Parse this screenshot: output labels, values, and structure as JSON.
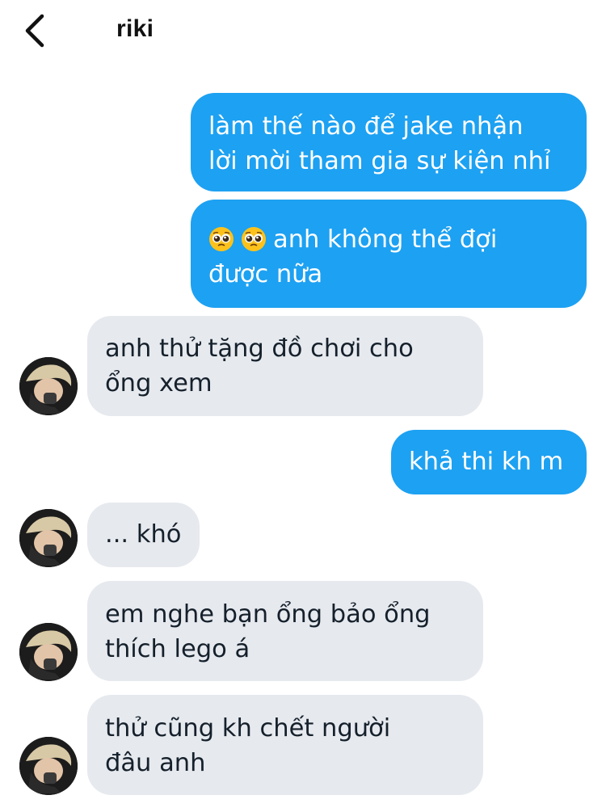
{
  "header": {
    "title": "riki",
    "back_icon": "chevron-left-icon"
  },
  "messages": [
    {
      "side": "out",
      "lines": [
        "làm thế nào để jake nhận",
        "lời mời tham gia sự kiện nhỉ"
      ]
    },
    {
      "side": "out",
      "emoji": "pleading-face-icon",
      "lines": [
        "anh không thể đợi",
        "được nữa"
      ]
    },
    {
      "side": "in",
      "lines": [
        "anh thử tặng đồ chơi cho",
        "ổng xem"
      ]
    },
    {
      "side": "out",
      "lines": [
        "khả thi kh m"
      ]
    },
    {
      "side": "in",
      "lines": [
        "... khó"
      ]
    },
    {
      "side": "in",
      "lines": [
        "em nghe bạn ổng bảo ổng",
        "thích lego á"
      ]
    },
    {
      "side": "in",
      "lines": [
        "thử cũng kh chết người",
        "đâu anh"
      ]
    }
  ],
  "colors": {
    "outgoing_bubble": "#1da1f2",
    "incoming_bubble": "#e6e9ee",
    "outgoing_text": "#ffffff",
    "incoming_text": "#15202b"
  }
}
